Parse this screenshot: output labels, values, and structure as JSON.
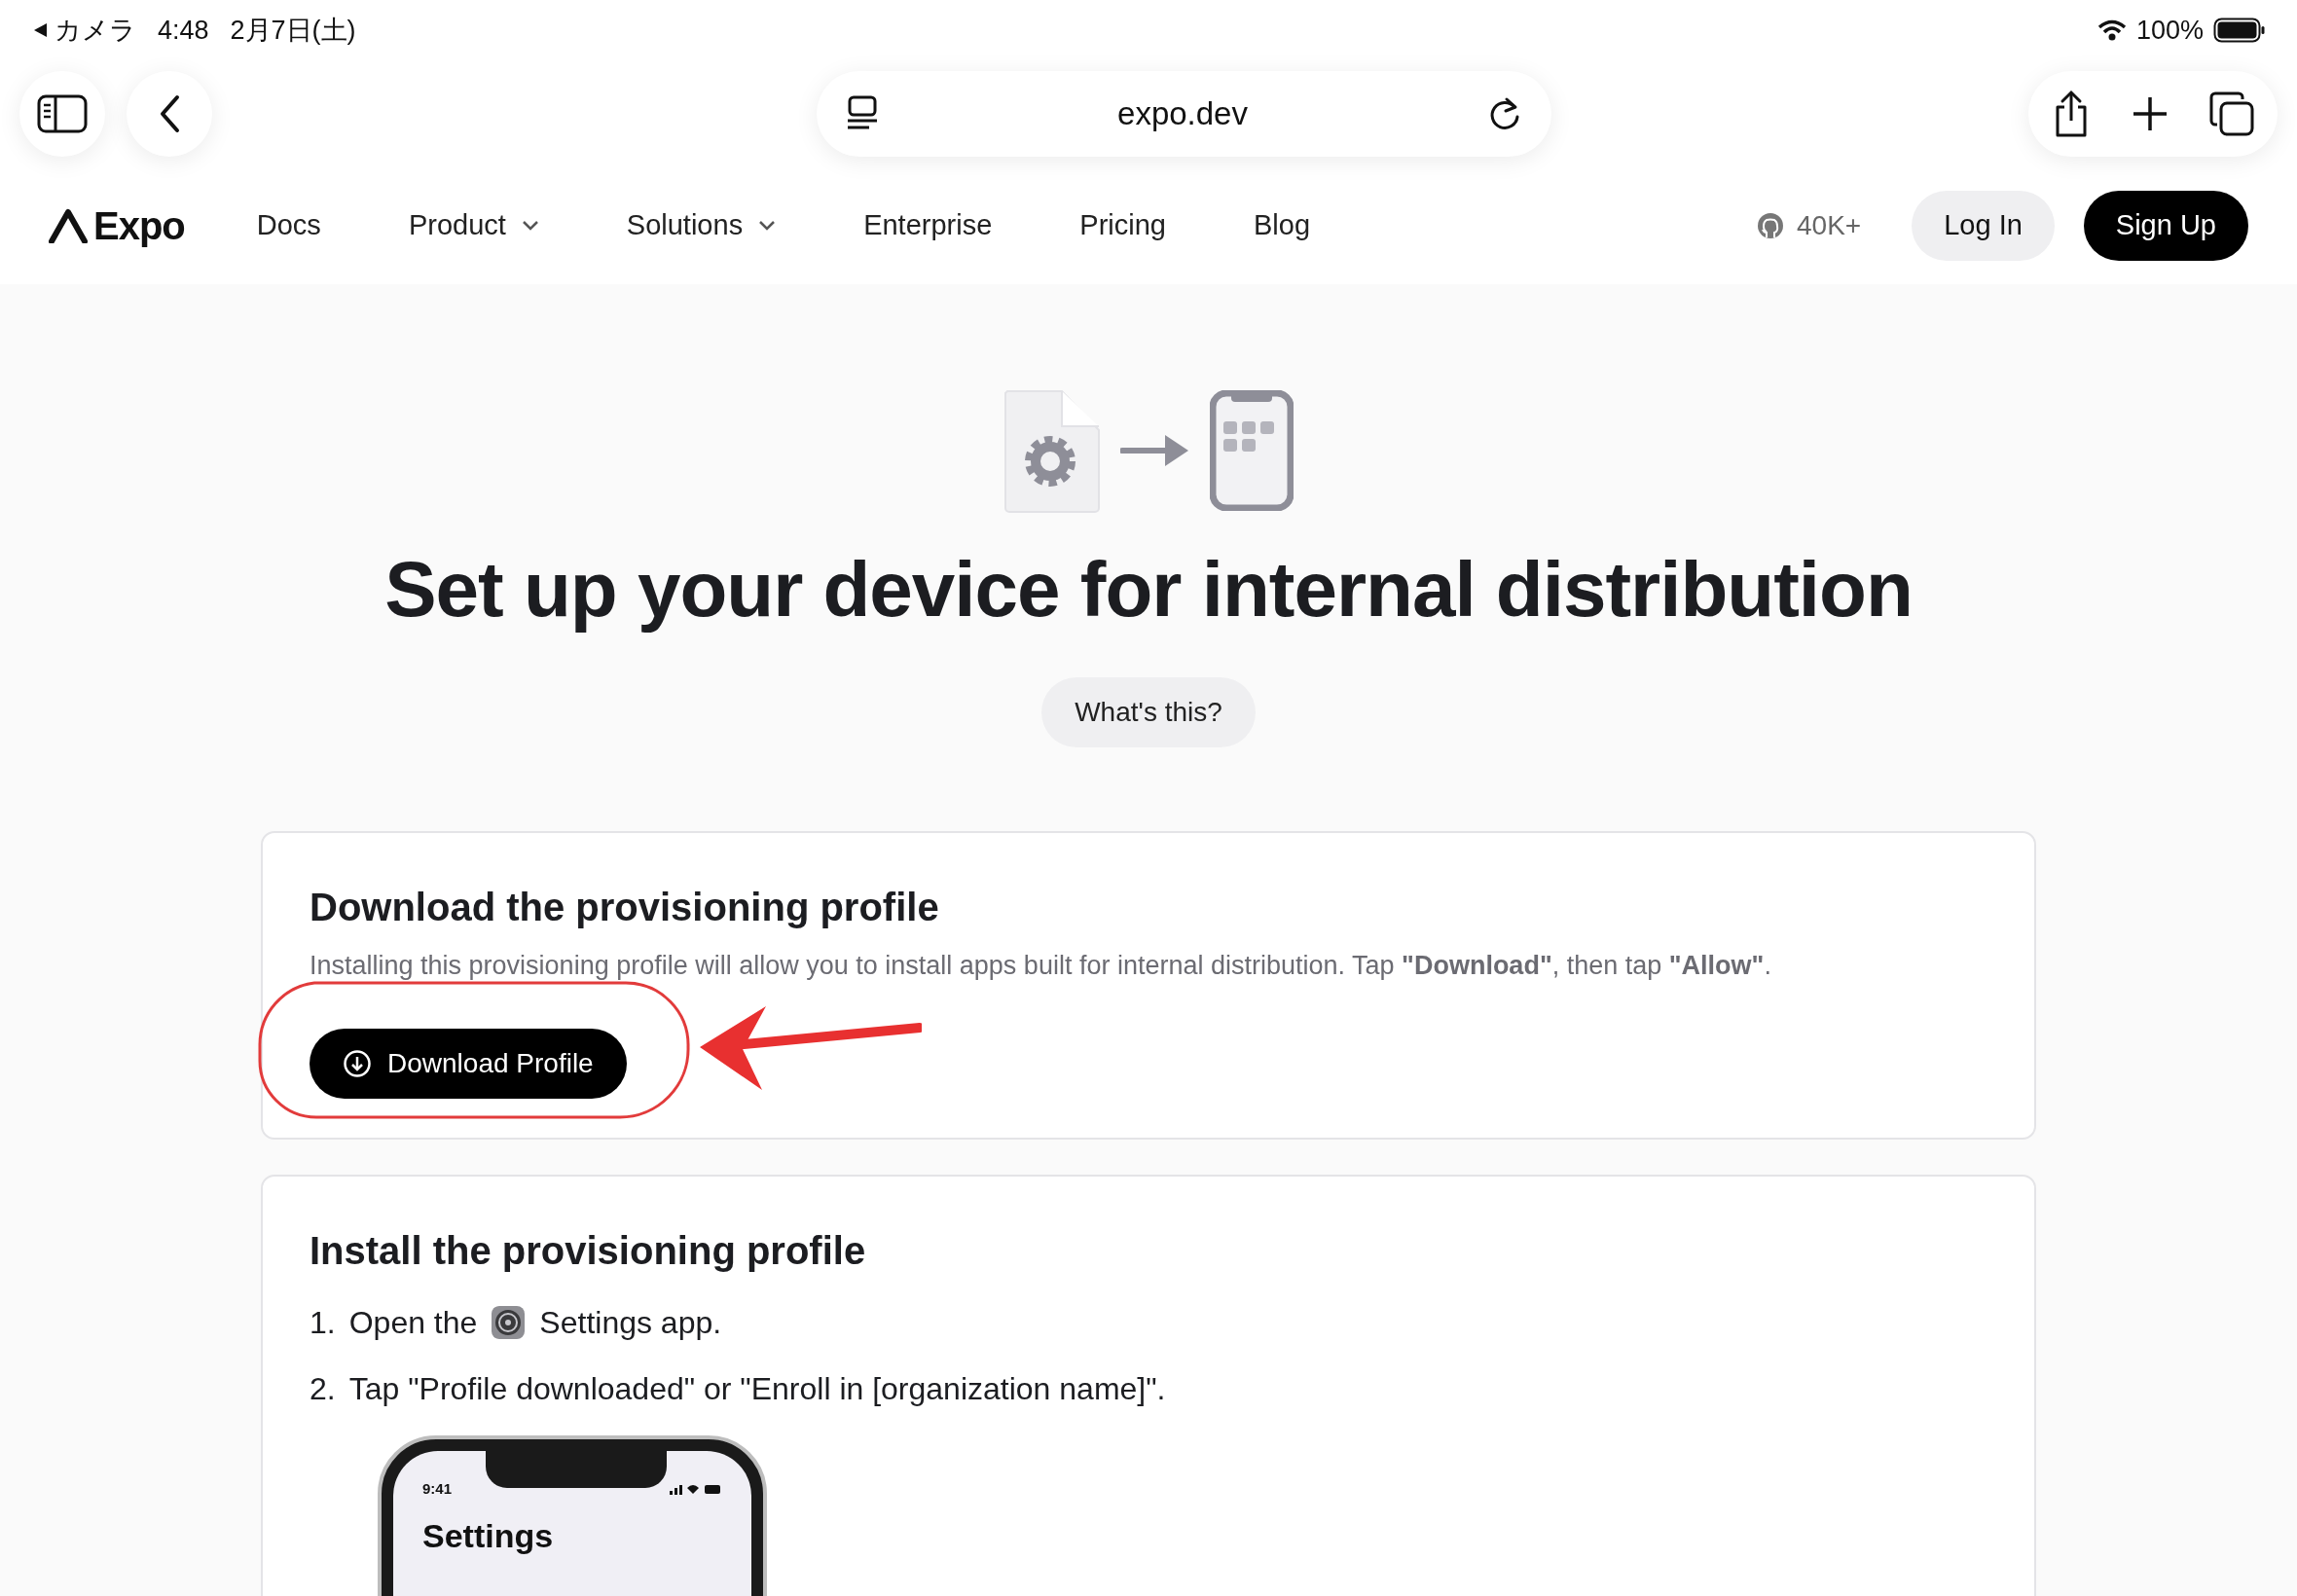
{
  "status_bar": {
    "back_app": "カメラ",
    "time": "4:48",
    "date": "2月7日(土)",
    "battery": "100%"
  },
  "browser": {
    "url": "expo.dev"
  },
  "nav": {
    "logo": "Expo",
    "items": [
      {
        "label": "Docs",
        "has_menu": false
      },
      {
        "label": "Product",
        "has_menu": true
      },
      {
        "label": "Solutions",
        "has_menu": true
      },
      {
        "label": "Enterprise",
        "has_menu": false
      },
      {
        "label": "Pricing",
        "has_menu": false
      },
      {
        "label": "Blog",
        "has_menu": false
      }
    ],
    "github_stars": "40K+",
    "login": "Log In",
    "signup": "Sign Up"
  },
  "hero": {
    "title": "Set up your device for internal distribution",
    "help_button": "What's this?"
  },
  "download_card": {
    "title": "Download the provisioning profile",
    "description": "Installing this provisioning profile will allow you to install apps built for internal distribution. Tap **\"Download\"**, then tap **\"Allow\"**.",
    "button": "Download Profile"
  },
  "install_card": {
    "title": "Install the provisioning profile",
    "steps": [
      {
        "kind": "app",
        "number": "1.",
        "before": "Open the",
        "after": "Settings app."
      },
      {
        "kind": "plain",
        "number": "2.",
        "text": "Tap \"Profile downloaded\" or \"Enroll in [organization name]\"."
      }
    ],
    "phone": {
      "time": "9:41",
      "title": "Settings"
    }
  }
}
